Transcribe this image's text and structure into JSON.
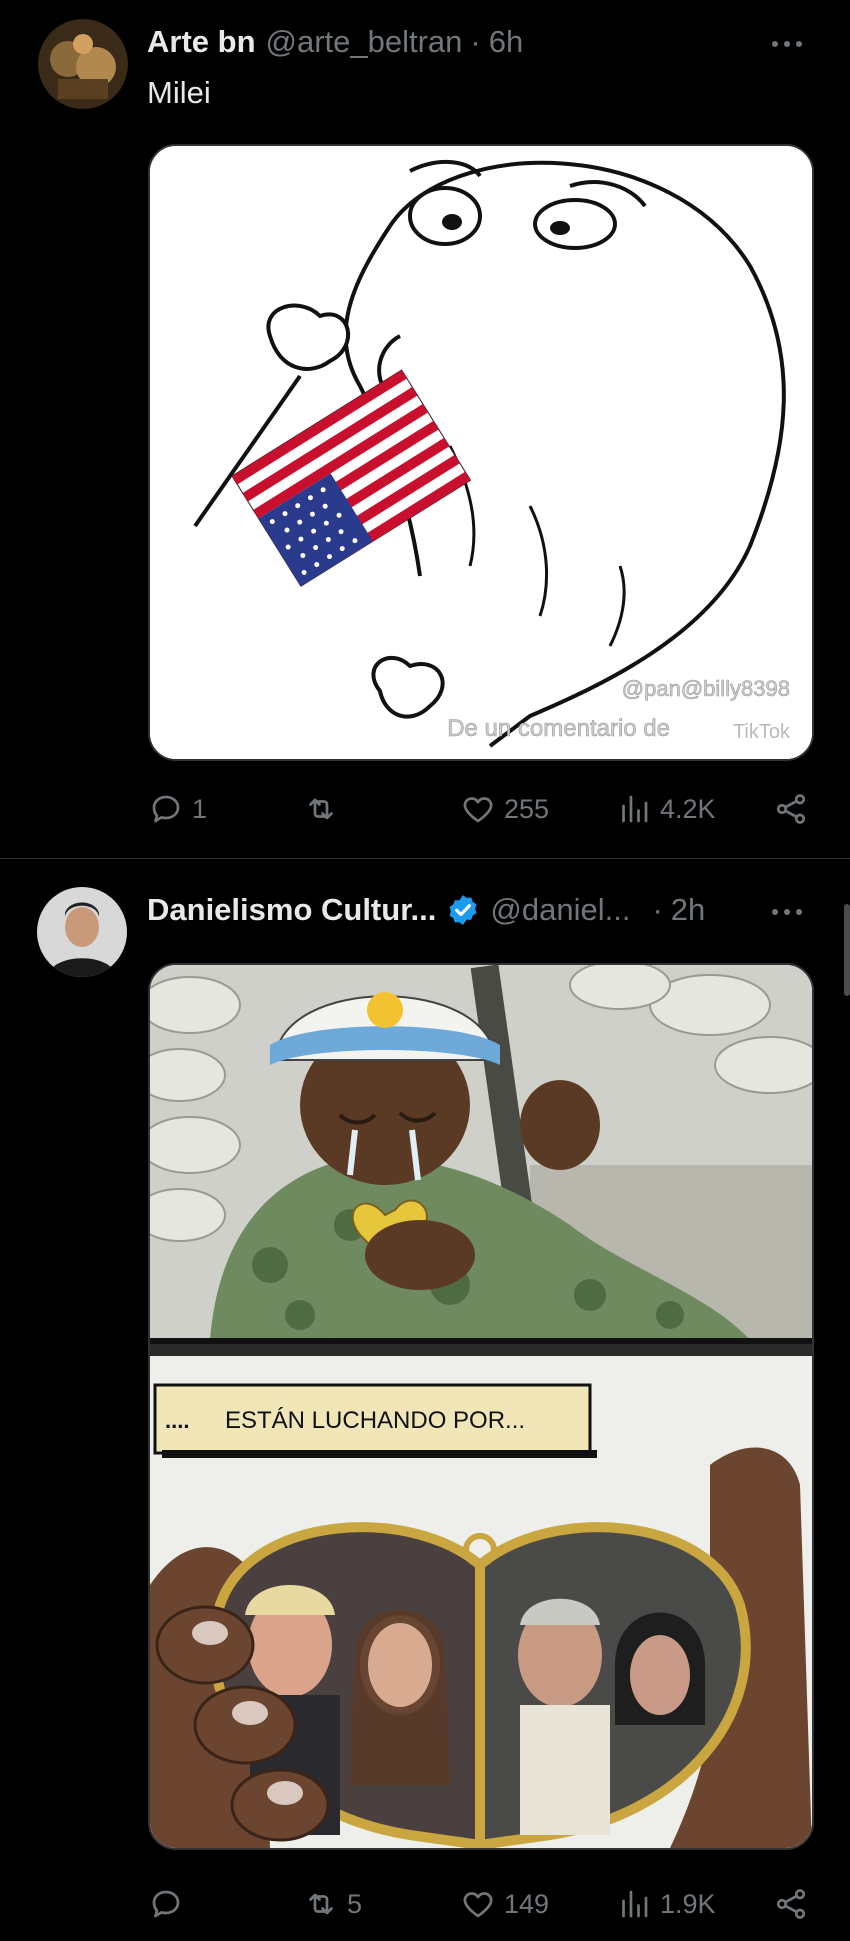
{
  "tweets": [
    {
      "display_name": "Arte bn",
      "handle": "@arte_beltran",
      "separator": "·",
      "time": "6h",
      "text": "Milei",
      "verified": false,
      "image_overlay": [
        "@pan@billy8398",
        "De un comentario de",
        "TikTok"
      ],
      "actions": {
        "replies": "1",
        "reposts": "",
        "likes": "255",
        "views": "4.2K"
      }
    },
    {
      "display_name": "Danielismo Cultur...",
      "handle": "@daniel...",
      "separator": "·",
      "time": "2h",
      "text": "",
      "verified": true,
      "image_caption": "ESTÁN LUCHANDO POR...",
      "image_caption_dots": "....",
      "actions": {
        "replies": "",
        "reposts": "5",
        "likes": "149",
        "views": "1.9K"
      }
    }
  ],
  "colors": {
    "background": "#000000",
    "text": "#e7e9ea",
    "muted": "#71767b",
    "verified": "#1d9bf0",
    "divider": "#2f3336"
  },
  "icons": [
    "reply-icon",
    "repost-icon",
    "like-icon",
    "views-icon",
    "share-icon",
    "more-icon",
    "verified-badge-icon"
  ]
}
